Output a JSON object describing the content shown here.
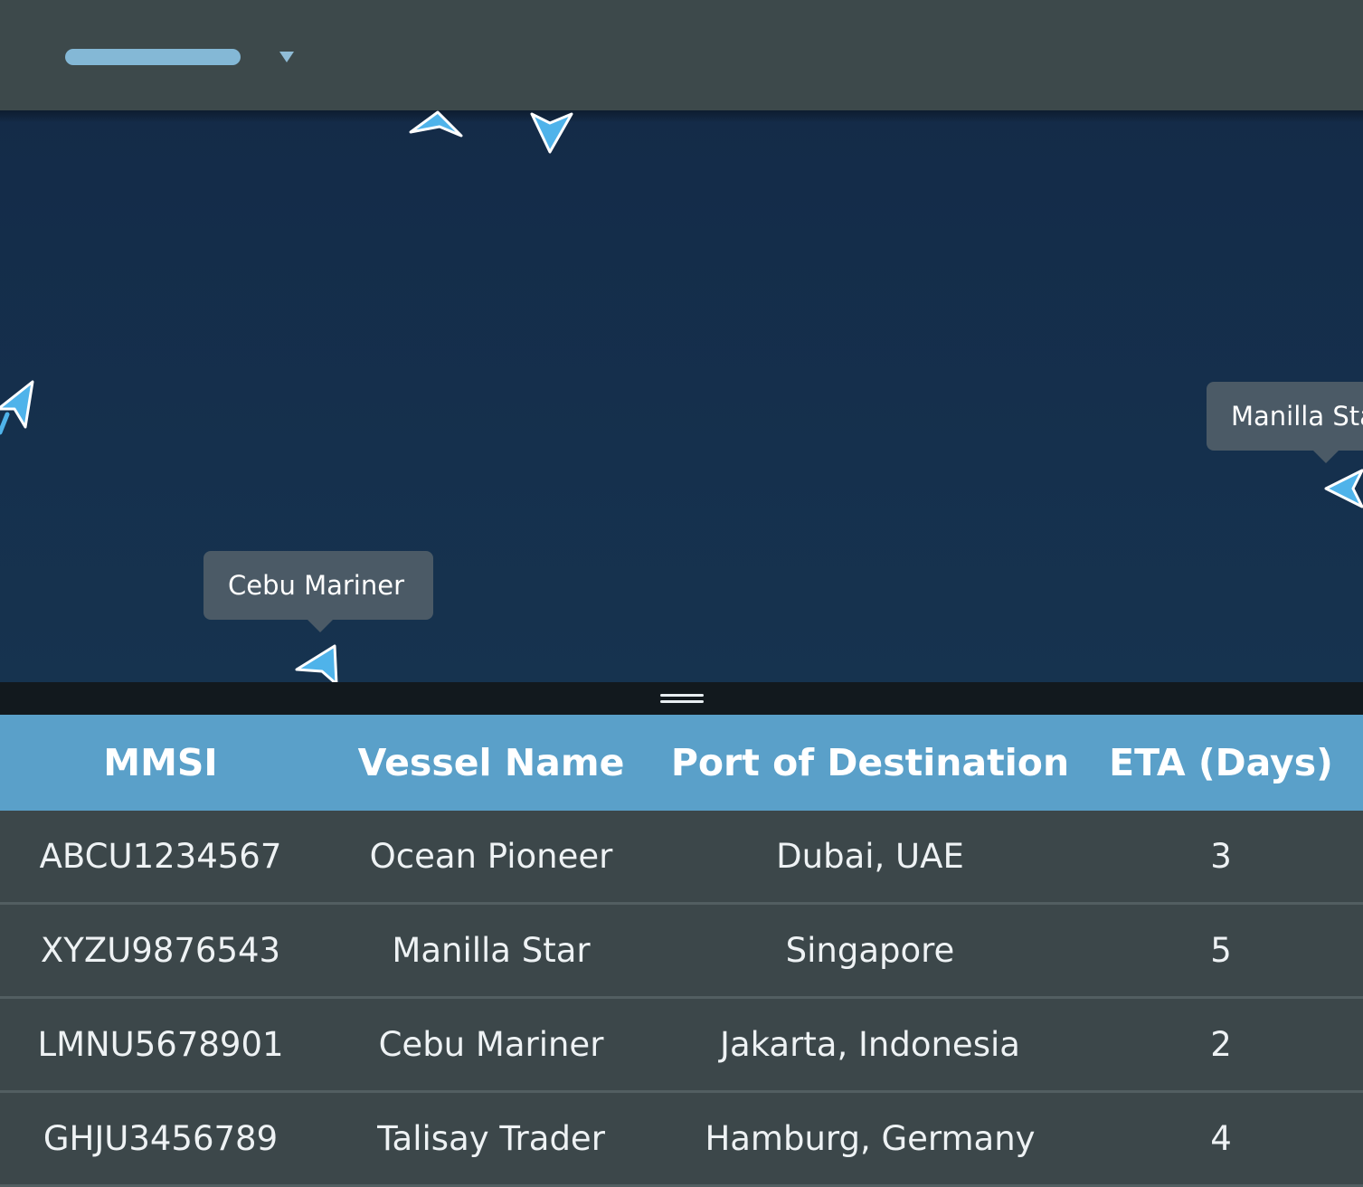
{
  "map": {
    "callouts": {
      "cebu": "Cebu Mariner",
      "manilla": "Manilla Star"
    }
  },
  "table": {
    "columns": [
      "MMSI",
      "Vessel Name",
      "Port of Destination",
      "ETA (Days)"
    ],
    "rows": [
      {
        "mmsi": "ABCU1234567",
        "vessel": "Ocean Pioneer",
        "port": "Dubai, UAE",
        "eta": "3"
      },
      {
        "mmsi": "XYZU9876543",
        "vessel": "Manilla Star",
        "port": "Singapore",
        "eta": "5"
      },
      {
        "mmsi": "LMNU5678901",
        "vessel": "Cebu Mariner",
        "port": "Jakarta, Indonesia",
        "eta": "2"
      },
      {
        "mmsi": "GHJU3456789",
        "vessel": "Talisay Trader",
        "port": "Hamburg, Germany",
        "eta": "4"
      }
    ]
  },
  "icons": {
    "dropdown": "chevron-down-icon",
    "vessel_marker": "vessel-marker-icon",
    "resize": "resize-handle-icon"
  },
  "colors": {
    "header_bar": "#5aa0c9",
    "map_water": "#15304d",
    "marker": "#4fb3ea",
    "topbar": "#3d494b"
  }
}
